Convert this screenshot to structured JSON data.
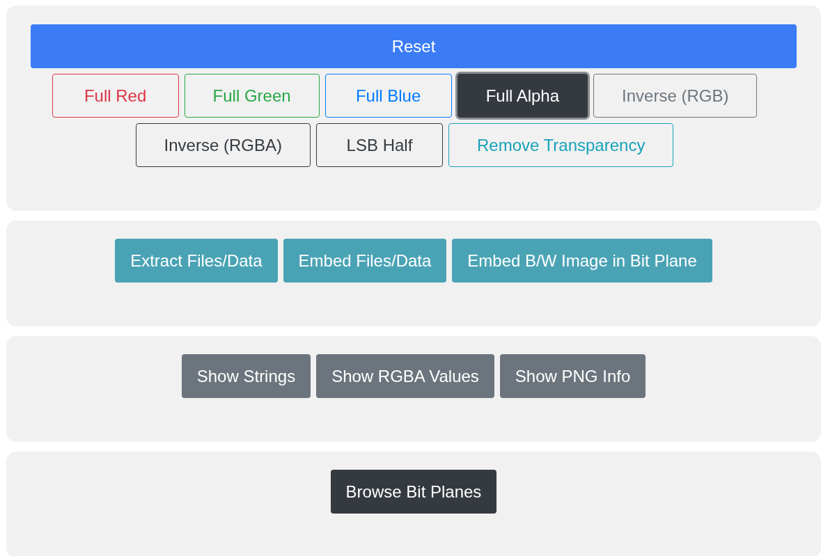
{
  "reset_button": {
    "label": "Reset"
  },
  "filter_rows": [
    [
      {
        "label": "Full Red",
        "color": "#dc3545",
        "selected": false
      },
      {
        "label": "Full Green",
        "color": "#28a745",
        "selected": false
      },
      {
        "label": "Full Blue",
        "color": "#007bff",
        "selected": false
      },
      {
        "label": "Full Alpha",
        "color": "#343a40",
        "selected": true
      },
      {
        "label": "Inverse (RGB)",
        "color": "#6c757d",
        "selected": false
      }
    ],
    [
      {
        "label": "Inverse (RGBA)",
        "color": "#343a40",
        "selected": false
      },
      {
        "label": "LSB Half",
        "color": "#343a40",
        "selected": false
      },
      {
        "label": "Remove Transparency",
        "color": "#17a2b8",
        "selected": false
      }
    ]
  ],
  "data_buttons": {
    "color": "#4aa3b5",
    "items": [
      "Extract Files/Data",
      "Embed Files/Data",
      "Embed B/W Image in Bit Plane"
    ]
  },
  "info_buttons": {
    "color": "#6c757d",
    "items": [
      "Show Strings",
      "Show RGBA Values",
      "Show PNG Info"
    ]
  },
  "plane_buttons": {
    "color": "#343a40",
    "items": [
      "Browse Bit Planes"
    ]
  }
}
